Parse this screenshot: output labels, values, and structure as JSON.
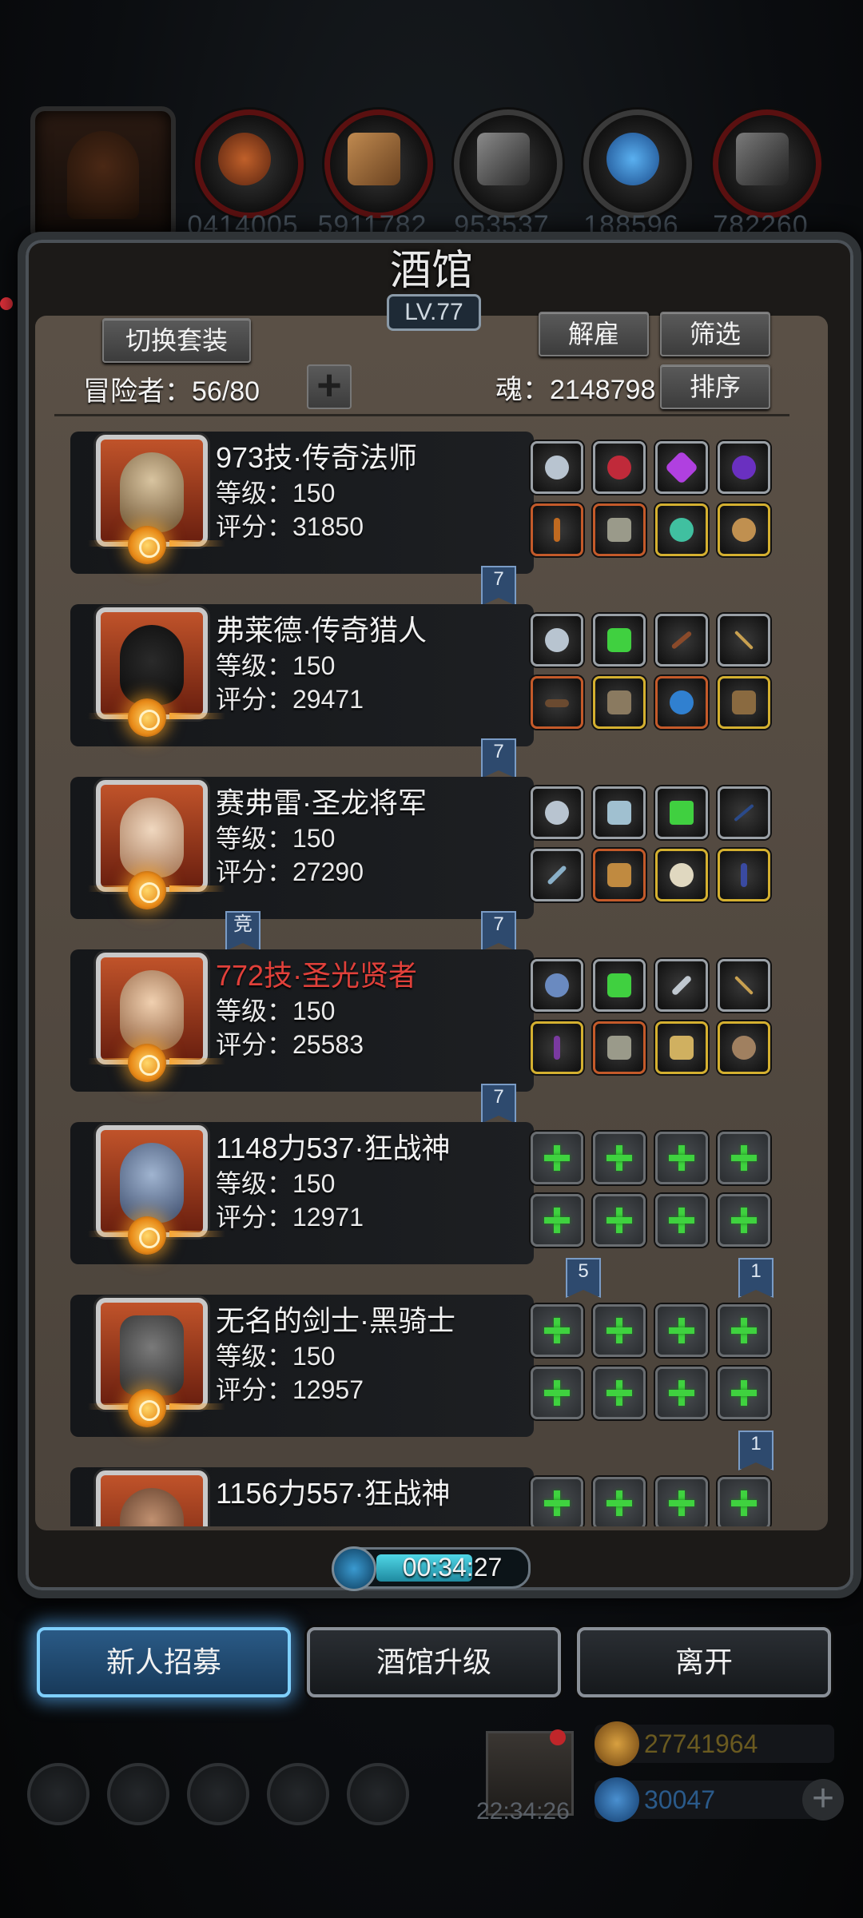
{
  "resources": {
    "values": [
      "0414005",
      "5911782",
      "953537",
      "188596",
      "782260"
    ],
    "icons": [
      "ore-icon",
      "wood-icon",
      "iron-icon",
      "crystal-icon",
      "stone-icon"
    ]
  },
  "tavern": {
    "title": "酒馆",
    "level": "LV.77",
    "switch_set_label": "切换套装",
    "dismiss_label": "解雇",
    "filter_label": "筛选",
    "sort_label": "排序",
    "adventurers_label": "冒险者：56/80",
    "soul_label": "魂：2148798",
    "add_label": "+"
  },
  "heroes": [
    {
      "name": "973技·传奇法师",
      "level": "等级：150",
      "score": "评分：31850",
      "name_color": "#f2f2f2",
      "ribbons": [
        "7"
      ]
    },
    {
      "name": "弗莱德·传奇猎人",
      "level": "等级：150",
      "score": "评分：29471",
      "name_color": "#f2f2f2",
      "ribbons": [
        "7"
      ]
    },
    {
      "name": "赛弗雷·圣龙将军",
      "level": "等级：150",
      "score": "评分：27290",
      "name_color": "#f2f2f2",
      "ribbons": [
        "竞",
        "7"
      ]
    },
    {
      "name": "772技·圣光贤者",
      "level": "等级：150",
      "score": "评分：25583",
      "name_color": "#e0403a",
      "ribbons": [
        "7"
      ]
    },
    {
      "name": "1148力537·狂战神",
      "level": "等级：150",
      "score": "评分：12971",
      "name_color": "#f2f2f2",
      "ribbons": [
        "5",
        "1"
      ]
    },
    {
      "name": "无名的剑士·黑骑士",
      "level": "等级：150",
      "score": "评分：12957",
      "name_color": "#f2f2f2",
      "ribbons": [
        "1"
      ]
    },
    {
      "name": "1156力557·狂战神",
      "level": "",
      "score": "",
      "name_color": "#f2f2f2",
      "ribbons": []
    }
  ],
  "timer": {
    "value": "00:34:27"
  },
  "buttons": {
    "recruit_label": "新人招募",
    "upgrade_label": "酒馆升级",
    "leave_label": "离开"
  },
  "footer": {
    "gift_time": "22:34:26",
    "gold": "27741964",
    "gems": "30047"
  }
}
